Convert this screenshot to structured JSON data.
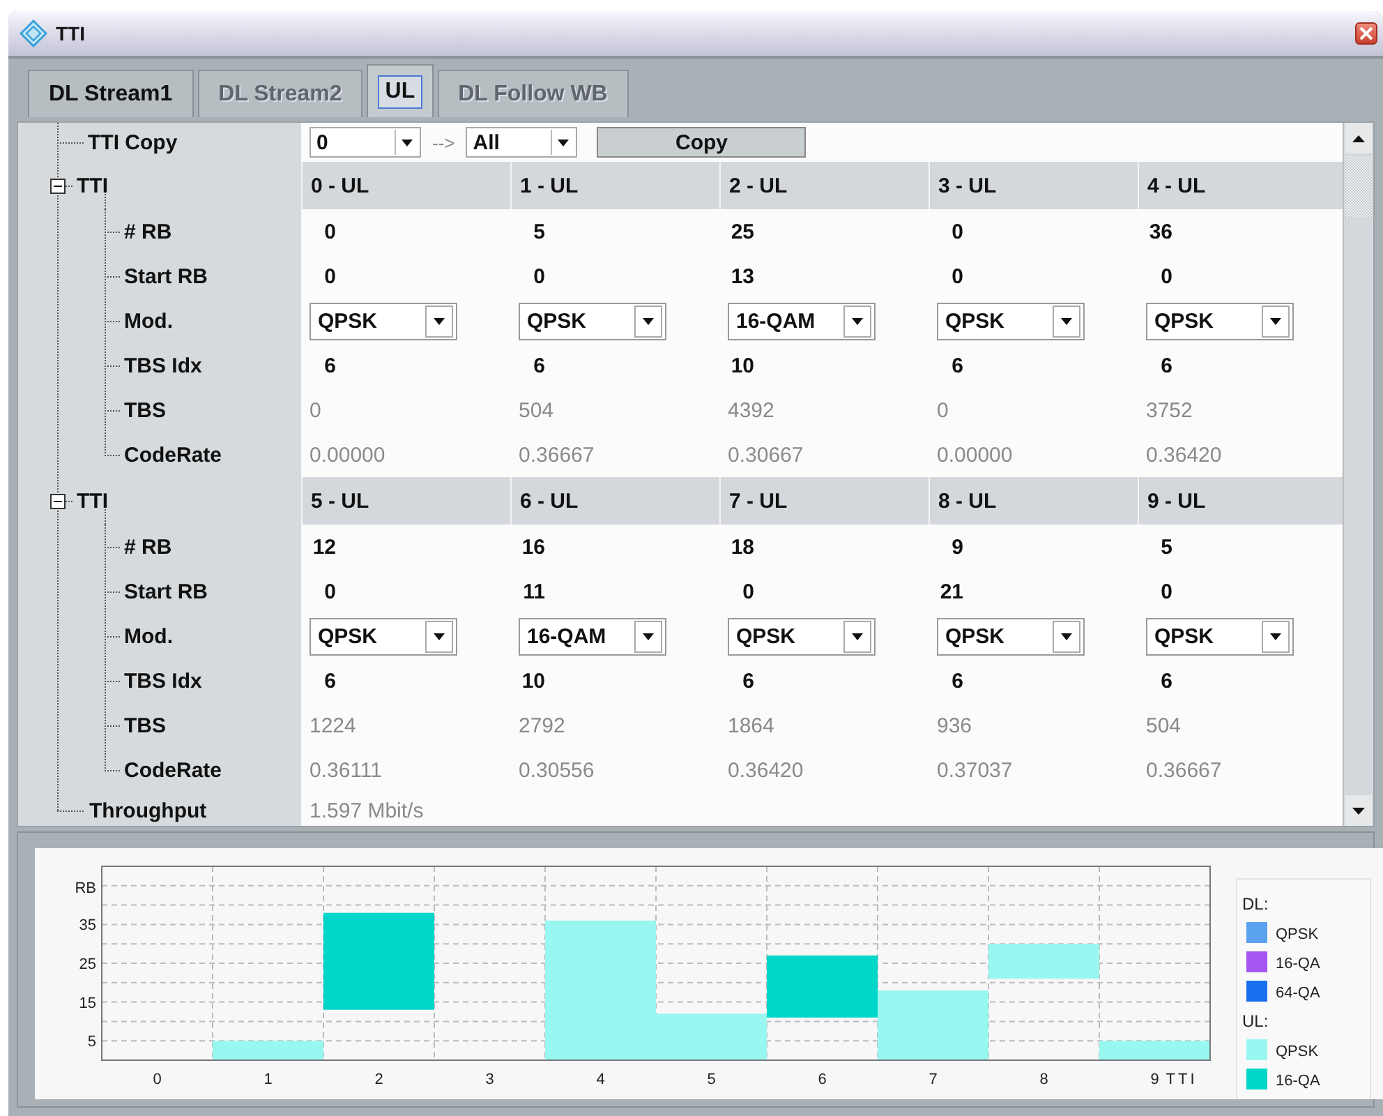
{
  "window": {
    "title": "TTI"
  },
  "tabs": [
    {
      "label": "DL Stream1",
      "selected": false,
      "disabled": false
    },
    {
      "label": "DL Stream2",
      "selected": false,
      "disabled": true
    },
    {
      "label": "UL",
      "selected": true,
      "disabled": false
    },
    {
      "label": "DL Follow WB",
      "selected": false,
      "disabled": true
    }
  ],
  "tti_copy": {
    "label": "TTI Copy",
    "from": "0",
    "arrow": "-->",
    "to": "All",
    "button": "Copy"
  },
  "groups": [
    {
      "label": "TTI",
      "expanded": true,
      "headers": [
        "0 - UL",
        "1 - UL",
        "2 - UL",
        "3 - UL",
        "4 - UL"
      ],
      "rows": [
        {
          "label": "# RB",
          "kind": "number",
          "values": [
            "0",
            "5",
            "25",
            "0",
            "36"
          ]
        },
        {
          "label": "Start RB",
          "kind": "number",
          "values": [
            "0",
            "0",
            "13",
            "0",
            "0"
          ]
        },
        {
          "label": "Mod.",
          "kind": "dropdown",
          "values": [
            {
              "text": "QPSK",
              "kind": "qpsk"
            },
            {
              "text": "QPSK",
              "kind": "qpsk"
            },
            {
              "text": "16-QAM",
              "kind": "qam16"
            },
            {
              "text": "QPSK",
              "kind": "qpsk"
            },
            {
              "text": "QPSK",
              "kind": "qpsk"
            }
          ]
        },
        {
          "label": "TBS Idx",
          "kind": "number",
          "values": [
            "6",
            "6",
            "10",
            "6",
            "6"
          ]
        },
        {
          "label": "TBS",
          "kind": "derived",
          "values": [
            "0",
            "504",
            "4392",
            "0",
            "3752"
          ]
        },
        {
          "label": "CodeRate",
          "kind": "derived",
          "values": [
            "0.00000",
            "0.36667",
            "0.30667",
            "0.00000",
            "0.36420"
          ]
        }
      ]
    },
    {
      "label": "TTI",
      "expanded": true,
      "headers": [
        "5 - UL",
        "6 - UL",
        "7 - UL",
        "8 - UL",
        "9 - UL"
      ],
      "rows": [
        {
          "label": "# RB",
          "kind": "number",
          "values": [
            "12",
            "16",
            "18",
            "9",
            "5"
          ]
        },
        {
          "label": "Start RB",
          "kind": "number",
          "values": [
            "0",
            "11",
            "0",
            "21",
            "0"
          ]
        },
        {
          "label": "Mod.",
          "kind": "dropdown",
          "values": [
            {
              "text": "QPSK",
              "kind": "qpsk"
            },
            {
              "text": "16-QAM",
              "kind": "qam16"
            },
            {
              "text": "QPSK",
              "kind": "qpsk"
            },
            {
              "text": "QPSK",
              "kind": "qpsk"
            },
            {
              "text": "QPSK",
              "kind": "qpsk"
            }
          ]
        },
        {
          "label": "TBS Idx",
          "kind": "number",
          "values": [
            "6",
            "10",
            "6",
            "6",
            "6"
          ]
        },
        {
          "label": "TBS",
          "kind": "derived",
          "values": [
            "1224",
            "2792",
            "1864",
            "936",
            "504"
          ]
        },
        {
          "label": "CodeRate",
          "kind": "derived",
          "values": [
            "0.36111",
            "0.30556",
            "0.36420",
            "0.37037",
            "0.36667"
          ]
        }
      ]
    }
  ],
  "throughput": {
    "label": "Throughput",
    "value": "1.597 Mbit/s"
  },
  "chart": {
    "y_axis_label": "RB",
    "x_axis_label": "TTI",
    "y_ticks": [
      "35",
      "25",
      "15",
      "5"
    ],
    "x_ticks": [
      "0",
      "1",
      "2",
      "3",
      "4",
      "5",
      "6",
      "7",
      "8",
      "9"
    ],
    "legend": [
      {
        "label": "DL:",
        "items": [
          {
            "label": "QPSK",
            "color": "#5aa2ee"
          },
          {
            "label": "16-QA",
            "color": "#a455f2"
          },
          {
            "label": "64-QA",
            "color": "#1a6ff0"
          }
        ]
      },
      {
        "label": "UL:",
        "items": [
          {
            "label": "QPSK",
            "color": "#99f7f2"
          },
          {
            "label": "16-QA",
            "color": "#00d6c9"
          }
        ]
      }
    ]
  }
}
